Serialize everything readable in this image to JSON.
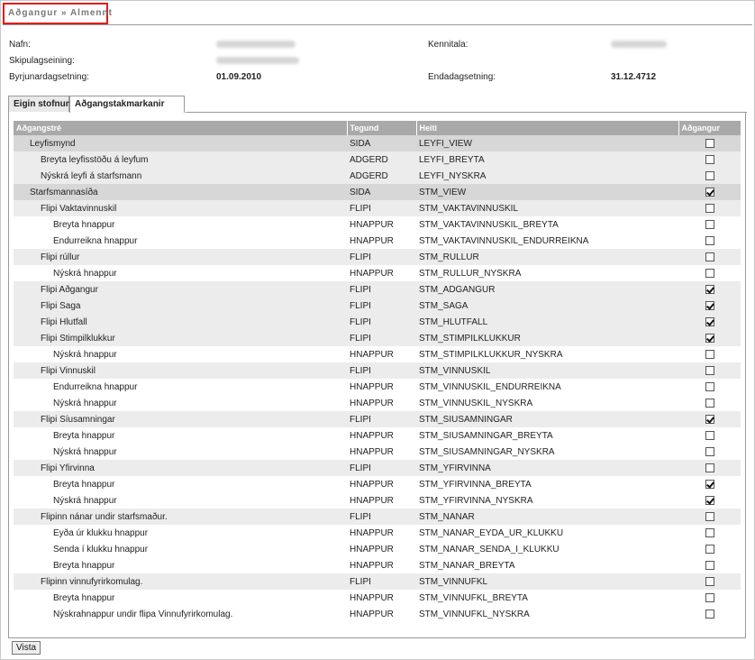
{
  "breadcrumb": "Aðgangur » Almennt",
  "info": {
    "nafn_label": "Nafn:",
    "kennitala_label": "Kennitala:",
    "skipulagseining_label": "Skipulagseining:",
    "byrjun_label": "Byrjunardagsetning:",
    "byrjun_value": "01.09.2010",
    "enda_label": "Endadagsetning:",
    "enda_value": "31.12.4712"
  },
  "tabs": [
    {
      "label": "Eigin stofnun",
      "active": false
    },
    {
      "label": "Aðgangstakmarkanir",
      "active": true
    }
  ],
  "table": {
    "headers": [
      "Aðgangstré",
      "Tegund",
      "Heiti",
      "Aðgangur"
    ],
    "rows": [
      {
        "name": "Leyfismynd",
        "type": "SIDA",
        "heiti": "LEYFI_VIEW",
        "checked": false,
        "level": 0
      },
      {
        "name": "Breyta leyfisstöðu á leyfum",
        "type": "ADGERD",
        "heiti": "LEYFI_BREYTA",
        "checked": false,
        "level": 1
      },
      {
        "name": "Nýskrá leyfi á starfsmann",
        "type": "ADGERD",
        "heiti": "LEYFI_NYSKRA",
        "checked": false,
        "level": 1
      },
      {
        "name": "Starfsmannasíða",
        "type": "SIDA",
        "heiti": "STM_VIEW",
        "checked": true,
        "level": 0
      },
      {
        "name": "Flipi Vaktavinnuskil",
        "type": "FLIPI",
        "heiti": "STM_VAKTAVINNUSKIL",
        "checked": false,
        "level": 1
      },
      {
        "name": "Breyta hnappur",
        "type": "HNAPPUR",
        "heiti": "STM_VAKTAVINNUSKIL_BREYTA",
        "checked": false,
        "level": 2
      },
      {
        "name": "Endurreikna hnappur",
        "type": "HNAPPUR",
        "heiti": "STM_VAKTAVINNUSKIL_ENDURREIKNA",
        "checked": false,
        "level": 2
      },
      {
        "name": "Flipi rúllur",
        "type": "FLIPI",
        "heiti": "STM_RULLUR",
        "checked": false,
        "level": 1
      },
      {
        "name": "Nýskrá hnappur",
        "type": "HNAPPUR",
        "heiti": "STM_RULLUR_NYSKRA",
        "checked": false,
        "level": 2
      },
      {
        "name": "Flipi Aðgangur",
        "type": "FLIPI",
        "heiti": "STM_ADGANGUR",
        "checked": true,
        "level": 1
      },
      {
        "name": "Flipi Saga",
        "type": "FLIPI",
        "heiti": "STM_SAGA",
        "checked": true,
        "level": 1
      },
      {
        "name": "Flipi Hlutfall",
        "type": "FLIPI",
        "heiti": "STM_HLUTFALL",
        "checked": true,
        "level": 1
      },
      {
        "name": "Flipi Stimpilklukkur",
        "type": "FLIPI",
        "heiti": "STM_STIMPILKLUKKUR",
        "checked": true,
        "level": 1
      },
      {
        "name": "Nýskrá hnappur",
        "type": "HNAPPUR",
        "heiti": "STM_STIMPILKLUKKUR_NYSKRA",
        "checked": false,
        "level": 2
      },
      {
        "name": "Flipi Vinnuskil",
        "type": "FLIPI",
        "heiti": "STM_VINNUSKIL",
        "checked": false,
        "level": 1
      },
      {
        "name": "Endurreikna hnappur",
        "type": "HNAPPUR",
        "heiti": "STM_VINNUSKIL_ENDURREIKNA",
        "checked": false,
        "level": 2
      },
      {
        "name": "Nýskrá hnappur",
        "type": "HNAPPUR",
        "heiti": "STM_VINNUSKIL_NYSKRA",
        "checked": false,
        "level": 2
      },
      {
        "name": "Flipi Síusamningar",
        "type": "FLIPI",
        "heiti": "STM_SIUSAMNINGAR",
        "checked": true,
        "level": 1
      },
      {
        "name": "Breyta hnappur",
        "type": "HNAPPUR",
        "heiti": "STM_SIUSAMNINGAR_BREYTA",
        "checked": false,
        "level": 2
      },
      {
        "name": "Nýskrá hnappur",
        "type": "HNAPPUR",
        "heiti": "STM_SIUSAMNINGAR_NYSKRA",
        "checked": false,
        "level": 2
      },
      {
        "name": "Flipi Yfirvinna",
        "type": "FLIPI",
        "heiti": "STM_YFIRVINNA",
        "checked": false,
        "level": 1
      },
      {
        "name": "Breyta hnappur",
        "type": "HNAPPUR",
        "heiti": "STM_YFIRVINNA_BREYTA",
        "checked": true,
        "level": 2
      },
      {
        "name": "Nýskrá hnappur",
        "type": "HNAPPUR",
        "heiti": "STM_YFIRVINNA_NYSKRA",
        "checked": true,
        "level": 2
      },
      {
        "name": "Flipinn nánar undir starfsmaður.",
        "type": "FLIPI",
        "heiti": "STM_NANAR",
        "checked": false,
        "level": 1
      },
      {
        "name": "Eyða úr klukku hnappur",
        "type": "HNAPPUR",
        "heiti": "STM_NANAR_EYDA_UR_KLUKKU",
        "checked": false,
        "level": 2
      },
      {
        "name": "Senda í klukku hnappur",
        "type": "HNAPPUR",
        "heiti": "STM_NANAR_SENDA_I_KLUKKU",
        "checked": false,
        "level": 2
      },
      {
        "name": "Breyta hnappur",
        "type": "HNAPPUR",
        "heiti": "STM_NANAR_BREYTA",
        "checked": false,
        "level": 2
      },
      {
        "name": "Flipinn vinnufyrirkomulag.",
        "type": "FLIPI",
        "heiti": "STM_VINNUFKL",
        "checked": false,
        "level": 1
      },
      {
        "name": "Breyta hnappur",
        "type": "HNAPPUR",
        "heiti": "STM_VINNUFKL_BREYTA",
        "checked": false,
        "level": 2
      },
      {
        "name": "Nýskrahnappur undir flipa Vinnufyrirkomulag.",
        "type": "HNAPPUR",
        "heiti": "STM_VINNUFKL_NYSKRA",
        "checked": false,
        "level": 2
      }
    ]
  },
  "actions": {
    "save_label": "Vista"
  }
}
